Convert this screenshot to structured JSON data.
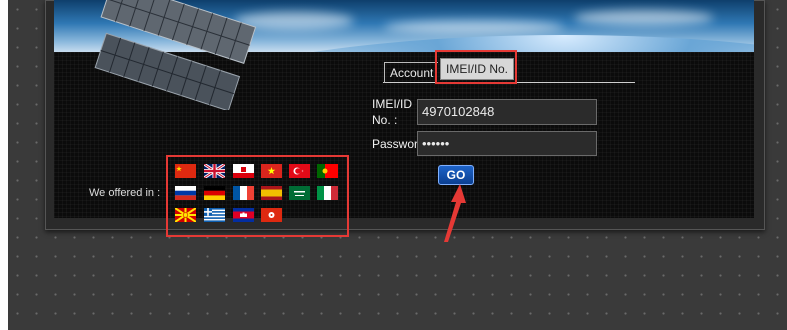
{
  "tabs": {
    "account": "Account",
    "imei": "IMEI/ID No."
  },
  "form": {
    "imei_label_line1": "IMEI/ID",
    "imei_label_line2": "No. :",
    "imei_value": "4970102848",
    "password_label": "Password :",
    "password_value": "••••••",
    "go_label": "GO"
  },
  "languages": {
    "label": "We offered in :",
    "flags": [
      "china",
      "united-kingdom",
      "gibraltar",
      "vietnam",
      "turkey",
      "portugal",
      "russia",
      "germany",
      "france",
      "spain",
      "saudi-arabia",
      "italy",
      "macedonia",
      "greece",
      "cambodia",
      "hong-kong"
    ]
  },
  "colors": {
    "highlight": "#e53935",
    "go_button": "#0b3f91",
    "tab_active_bg": "#d7d7d7"
  }
}
